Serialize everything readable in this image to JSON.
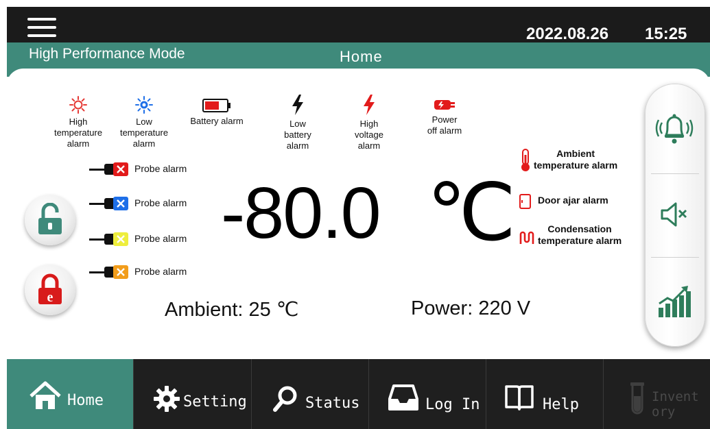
{
  "header": {
    "menu_icon": "hamburger-menu-icon",
    "date": "2022.08.26",
    "time": "15:25"
  },
  "modebar": {
    "mode": "High Performance Mode",
    "page_title": "Home"
  },
  "alarm_legend": [
    {
      "icon": "high-temperature-sun-icon",
      "color": "#e53935",
      "label": "High\ntemperature\nalarm"
    },
    {
      "icon": "low-temperature-snow-icon",
      "color": "#1e6fe8",
      "label": "Low\ntemperature\nalarm"
    },
    {
      "icon": "battery-icon",
      "color": "#e21b1b",
      "label": "Battery alarm"
    },
    {
      "icon": "lightning-icon",
      "color": "#111111",
      "label": "Low\nbattery\nalarm"
    },
    {
      "icon": "lightning-icon",
      "color": "#e21b1b",
      "label": "High\nvoltage\nalarm"
    },
    {
      "icon": "power-plug-icon",
      "color": "#e21b1b",
      "label": "Power\noff alarm"
    }
  ],
  "probes": [
    {
      "label": "Probe alarm",
      "color": "#e21b1b"
    },
    {
      "label": "Probe alarm",
      "color": "#1e6fe8"
    },
    {
      "label": "Probe alarm",
      "color": "#e8e83a"
    },
    {
      "label": "Probe alarm",
      "color": "#f29d1b"
    }
  ],
  "temperature": {
    "value": "-80.0",
    "unit": "℃"
  },
  "readings": {
    "ambient": "Ambient: 25 ℃",
    "power": "Power: 220 V"
  },
  "right_alarms": {
    "ambient": "Ambient\ntemperature alarm",
    "door": "Door ajar alarm",
    "condensation": "Condensation\ntemperature alarm"
  },
  "nav": {
    "home": "Home",
    "setting": "Setting",
    "status": "Status",
    "login": "Log In",
    "help": "Help",
    "inventory": "Invent\nory"
  },
  "colors": {
    "accent": "#3f8a7b",
    "alarm_red": "#e21b1b",
    "alarm_blue": "#1e6fe8",
    "bell_green": "#2e7d5b"
  }
}
